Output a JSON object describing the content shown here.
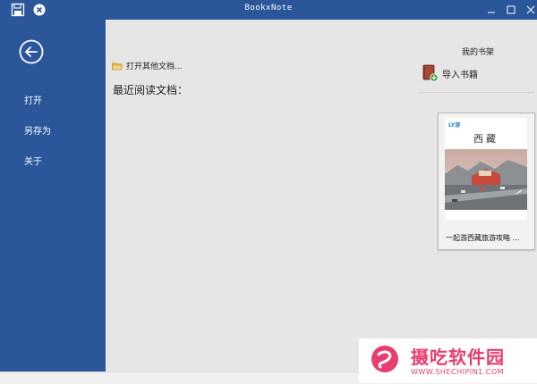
{
  "window": {
    "title": "BookxNote"
  },
  "sidebar": {
    "items": [
      {
        "label": "打开"
      },
      {
        "label": "另存为"
      },
      {
        "label": "关于"
      }
    ]
  },
  "main": {
    "open_other_label": "打开其他文档...",
    "recent_title": "最近阅读文档："
  },
  "shelf": {
    "title": "我的书架",
    "import_label": "导入书籍",
    "books": [
      {
        "cover_brand": "LY游",
        "cover_title": "西藏",
        "title": "一起游西藏旅游攻略 …"
      }
    ]
  },
  "watermark": {
    "text": "摄吃软件园",
    "url": "WWW.SHECHIPIN1.COM"
  },
  "colors": {
    "accent": "#2b579a",
    "background": "#e6e6e6",
    "watermark": "#e83e6f"
  }
}
